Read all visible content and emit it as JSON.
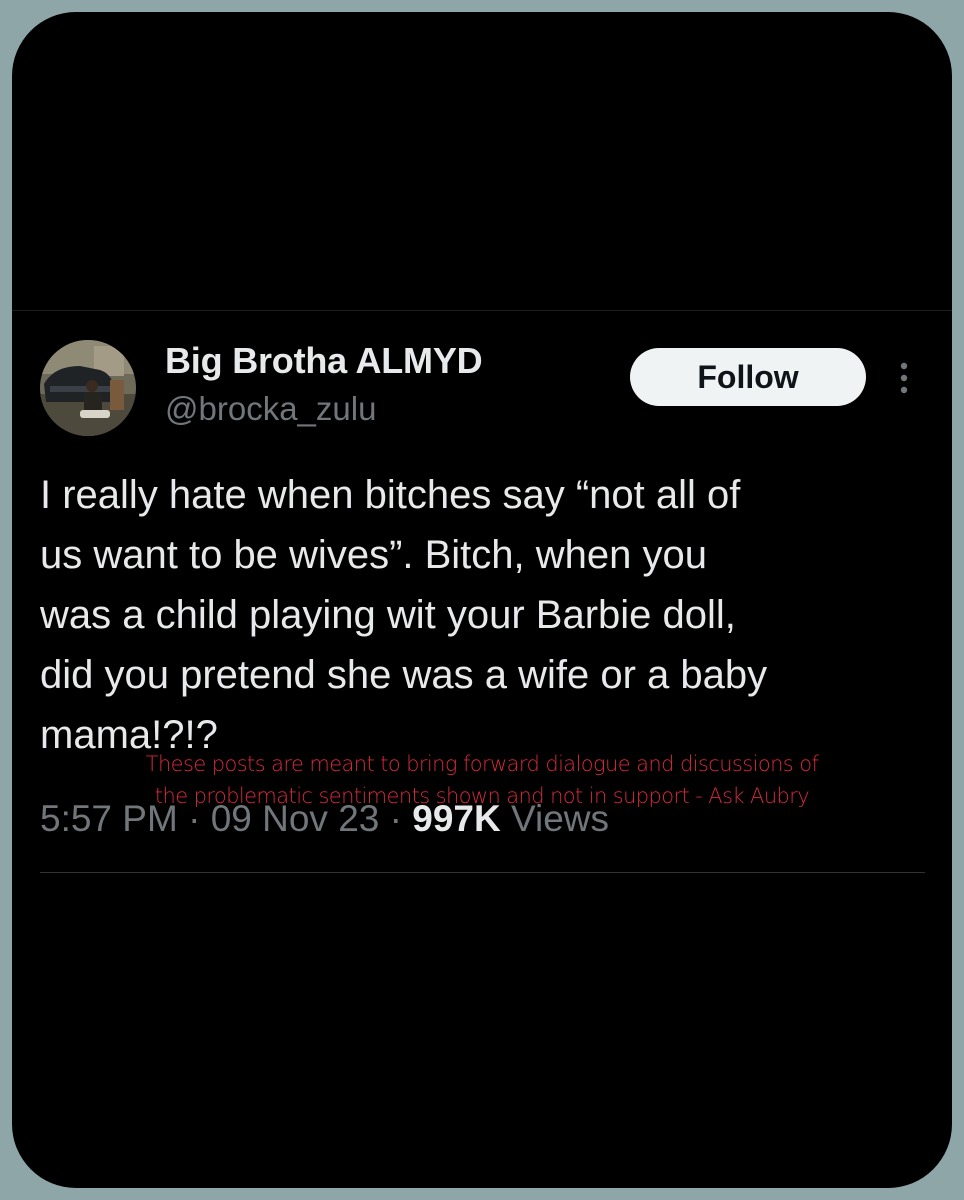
{
  "author": {
    "display_name": "Big Brotha ALMYD",
    "handle": "@brocka_zulu"
  },
  "follow_button_label": "Follow",
  "tweet": {
    "lines": [
      "I really hate when bitches say “not all of",
      "us want to be wives”. Bitch, when you",
      "was a child playing wit your Barbie doll,",
      "did you pretend she was a wife or a baby",
      "mama!?!?"
    ]
  },
  "meta": {
    "time": "5:57 PM",
    "date": "09 Nov 23",
    "separator": "·",
    "views_count": "997K",
    "views_label": "Views"
  },
  "watermark": {
    "lines": [
      "These posts are meant to bring forward dialogue and discussions of",
      "the problematic sentiments shown and not in support - Ask Aubry"
    ]
  },
  "colors": {
    "outer_background": "#8ea6a8",
    "card_background": "#000000",
    "primary_text": "#e7e9ea",
    "secondary_text": "#71767b",
    "watermark_text": "#d7293a"
  },
  "icons": {
    "more": "more-vertical-icon"
  }
}
